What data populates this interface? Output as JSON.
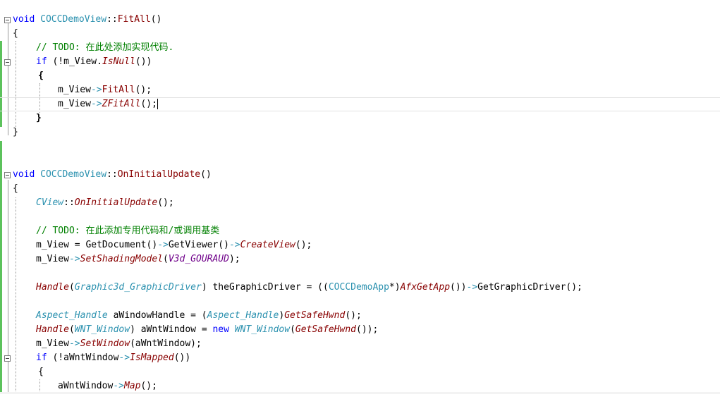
{
  "editor": {
    "lines": [
      {
        "text": "void COCCDemoView::FitAll()"
      },
      {
        "text": "{"
      },
      {
        "text": "// TODO: 在此处添加实现代码."
      },
      {
        "text": "if (!m_View.IsNull())"
      },
      {
        "text": "{"
      },
      {
        "text": "m_View->FitAll();"
      },
      {
        "text": "m_View->ZFitAll();"
      },
      {
        "text": "}"
      },
      {
        "text": "}"
      },
      {
        "text": "void COCCDemoView::OnInitialUpdate()"
      },
      {
        "text": "{"
      },
      {
        "text": "CView::OnInitialUpdate();"
      },
      {
        "text": "// TODO: 在此添加专用代码和/或调用基类"
      },
      {
        "text": "m_View = GetDocument()->GetViewer()->CreateView();"
      },
      {
        "text": "m_View->SetShadingModel(V3d_GOURAUD);"
      },
      {
        "text": "Handle(Graphic3d_GraphicDriver) theGraphicDriver = ((COCCDemoApp*)AfxGetApp())->GetGraphicDriver();"
      },
      {
        "text": "Aspect_Handle aWindowHandle = (Aspect_Handle)GetSafeHwnd();"
      },
      {
        "text": "Handle(WNT_Window) aWntWindow = new WNT_Window(GetSafeHwnd());"
      },
      {
        "text": "m_View->SetWindow(aWntWindow);"
      },
      {
        "text": "if (!aWntWindow->IsMapped())"
      },
      {
        "text": "{"
      },
      {
        "text": "aWntWindow->Map();"
      }
    ]
  }
}
